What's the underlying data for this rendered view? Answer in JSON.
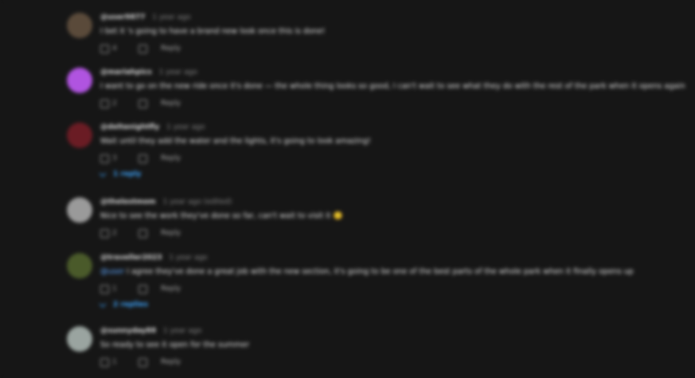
{
  "comments": [
    {
      "author": "@user9877",
      "time": "1 year ago",
      "text": "I bet it 's going to have a brand new look once this is done!",
      "likes": "4",
      "reply_label": "Reply",
      "replies": "",
      "avatar_color": "#5a4a3a"
    },
    {
      "author": "@mariahpics",
      "time": "1 year ago",
      "text": "I want to go on the new ride once it's done — the whole thing looks so good, I can't wait to see what they do with the rest of the park when it opens again",
      "likes": "2",
      "reply_label": "Reply",
      "replies": "",
      "avatar_color": "#b054e0"
    },
    {
      "author": "@deltanightfly",
      "time": "1 year ago",
      "text": "Wait until they add the water and the lights, it's going to look amazing!",
      "likes": "3",
      "reply_label": "Reply",
      "replies": "1 reply",
      "avatar_color": "#6a1c24"
    },
    {
      "author": "@thelostmom",
      "time": "1 year ago (edited)",
      "text": "Nice to see the work they've done so far, can't wait to visit it 🙂",
      "likes": "2",
      "reply_label": "Reply",
      "replies": "",
      "avatar_color": "#9a9a9a"
    },
    {
      "author": "@traveller2023",
      "time": "1 year ago",
      "mention": "@user",
      "text": " I agree they've done a great job with the new section, it's going to be one of the best parts of the whole park when it finally opens up",
      "likes": "1",
      "reply_label": "Reply",
      "replies": "2 replies",
      "avatar_color": "#4a5a2a"
    },
    {
      "author": "@sunnyday88",
      "time": "1 year ago",
      "text": "So ready to see it open for the summer",
      "likes": "1",
      "reply_label": "Reply",
      "replies": "",
      "avatar_color": "#9aa4a0"
    }
  ]
}
